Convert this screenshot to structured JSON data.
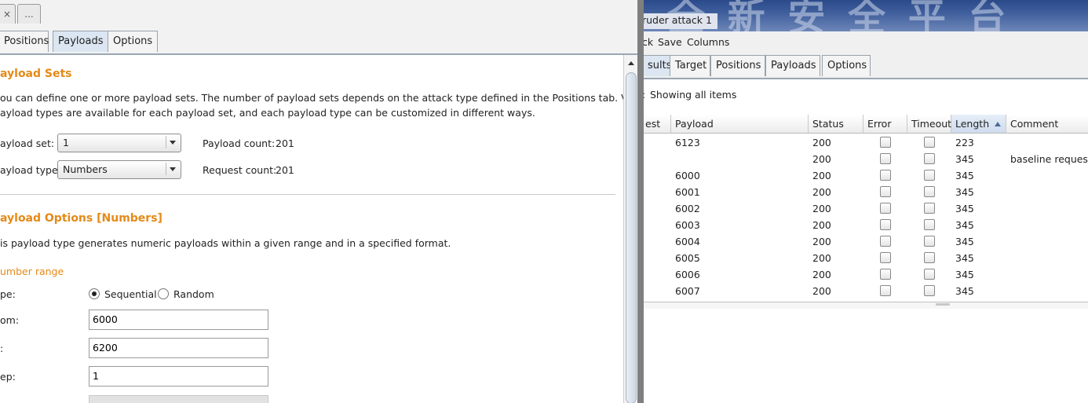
{
  "left": {
    "top_tabs": [
      {
        "label": "×"
      },
      {
        "label": "..."
      }
    ],
    "tabs": [
      {
        "label": "Positions",
        "active": false
      },
      {
        "label": "Payloads",
        "active": true
      },
      {
        "label": "Options",
        "active": false
      }
    ],
    "payload_sets": {
      "heading": "ayload Sets",
      "desc_line1": "ou can define one or more payload sets. The number of payload sets depends on the attack type defined in the Positions tab. Various",
      "desc_line2": "ayload types are available for each payload set, and each payload type can be customized in different ways.",
      "set_label": "ayload set:",
      "set_value": "1",
      "type_label": "ayload type:",
      "type_value": "Numbers",
      "payload_count_label": "Payload count:",
      "payload_count": "201",
      "request_count_label": "Request count:",
      "request_count": "201"
    },
    "payload_options": {
      "heading": "ayload Options [Numbers]",
      "desc": "is payload type generates numeric payloads within a given range and in a specified format.",
      "range_label": "umber range",
      "type_label": "pe:",
      "sequential_label": "Sequential",
      "random_label": "Random",
      "selected": "Sequential",
      "from_label": "om:",
      "from_value": "6000",
      "to_label": ":",
      "to_value": "6200",
      "step_label": "ep:",
      "step_value": "1"
    }
  },
  "right": {
    "title": "ruder attack 1",
    "title_bg_glyphs": "全 新 安 全 平 台",
    "menu": [
      "ck",
      "Save",
      "Columns"
    ],
    "tabs": [
      {
        "label": "sults",
        "active": true
      },
      {
        "label": "Target",
        "active": false
      },
      {
        "label": "Positions",
        "active": false
      },
      {
        "label": "Payloads",
        "active": false
      },
      {
        "label": "Options",
        "active": false
      }
    ],
    "filter": {
      "prefix": ":",
      "text": "Showing all items"
    },
    "columns": [
      "est",
      "Payload",
      "Status",
      "Error",
      "Timeout",
      "Length",
      "Comment"
    ],
    "sorted_column": "Length",
    "rows": [
      {
        "payload": "6123",
        "status": "200",
        "length": "223",
        "comment": ""
      },
      {
        "payload": "",
        "status": "200",
        "length": "345",
        "comment": "baseline request"
      },
      {
        "payload": "6000",
        "status": "200",
        "length": "345",
        "comment": ""
      },
      {
        "payload": "6001",
        "status": "200",
        "length": "345",
        "comment": ""
      },
      {
        "payload": "6002",
        "status": "200",
        "length": "345",
        "comment": ""
      },
      {
        "payload": "6003",
        "status": "200",
        "length": "345",
        "comment": ""
      },
      {
        "payload": "6004",
        "status": "200",
        "length": "345",
        "comment": ""
      },
      {
        "payload": "6005",
        "status": "200",
        "length": "345",
        "comment": ""
      },
      {
        "payload": "6006",
        "status": "200",
        "length": "345",
        "comment": ""
      },
      {
        "payload": "6007",
        "status": "200",
        "length": "345",
        "comment": ""
      }
    ]
  },
  "colors": {
    "accent_orange": "#e58a17",
    "active_tab": "#dbe6f2",
    "title_blue": "#2b4a8a"
  }
}
